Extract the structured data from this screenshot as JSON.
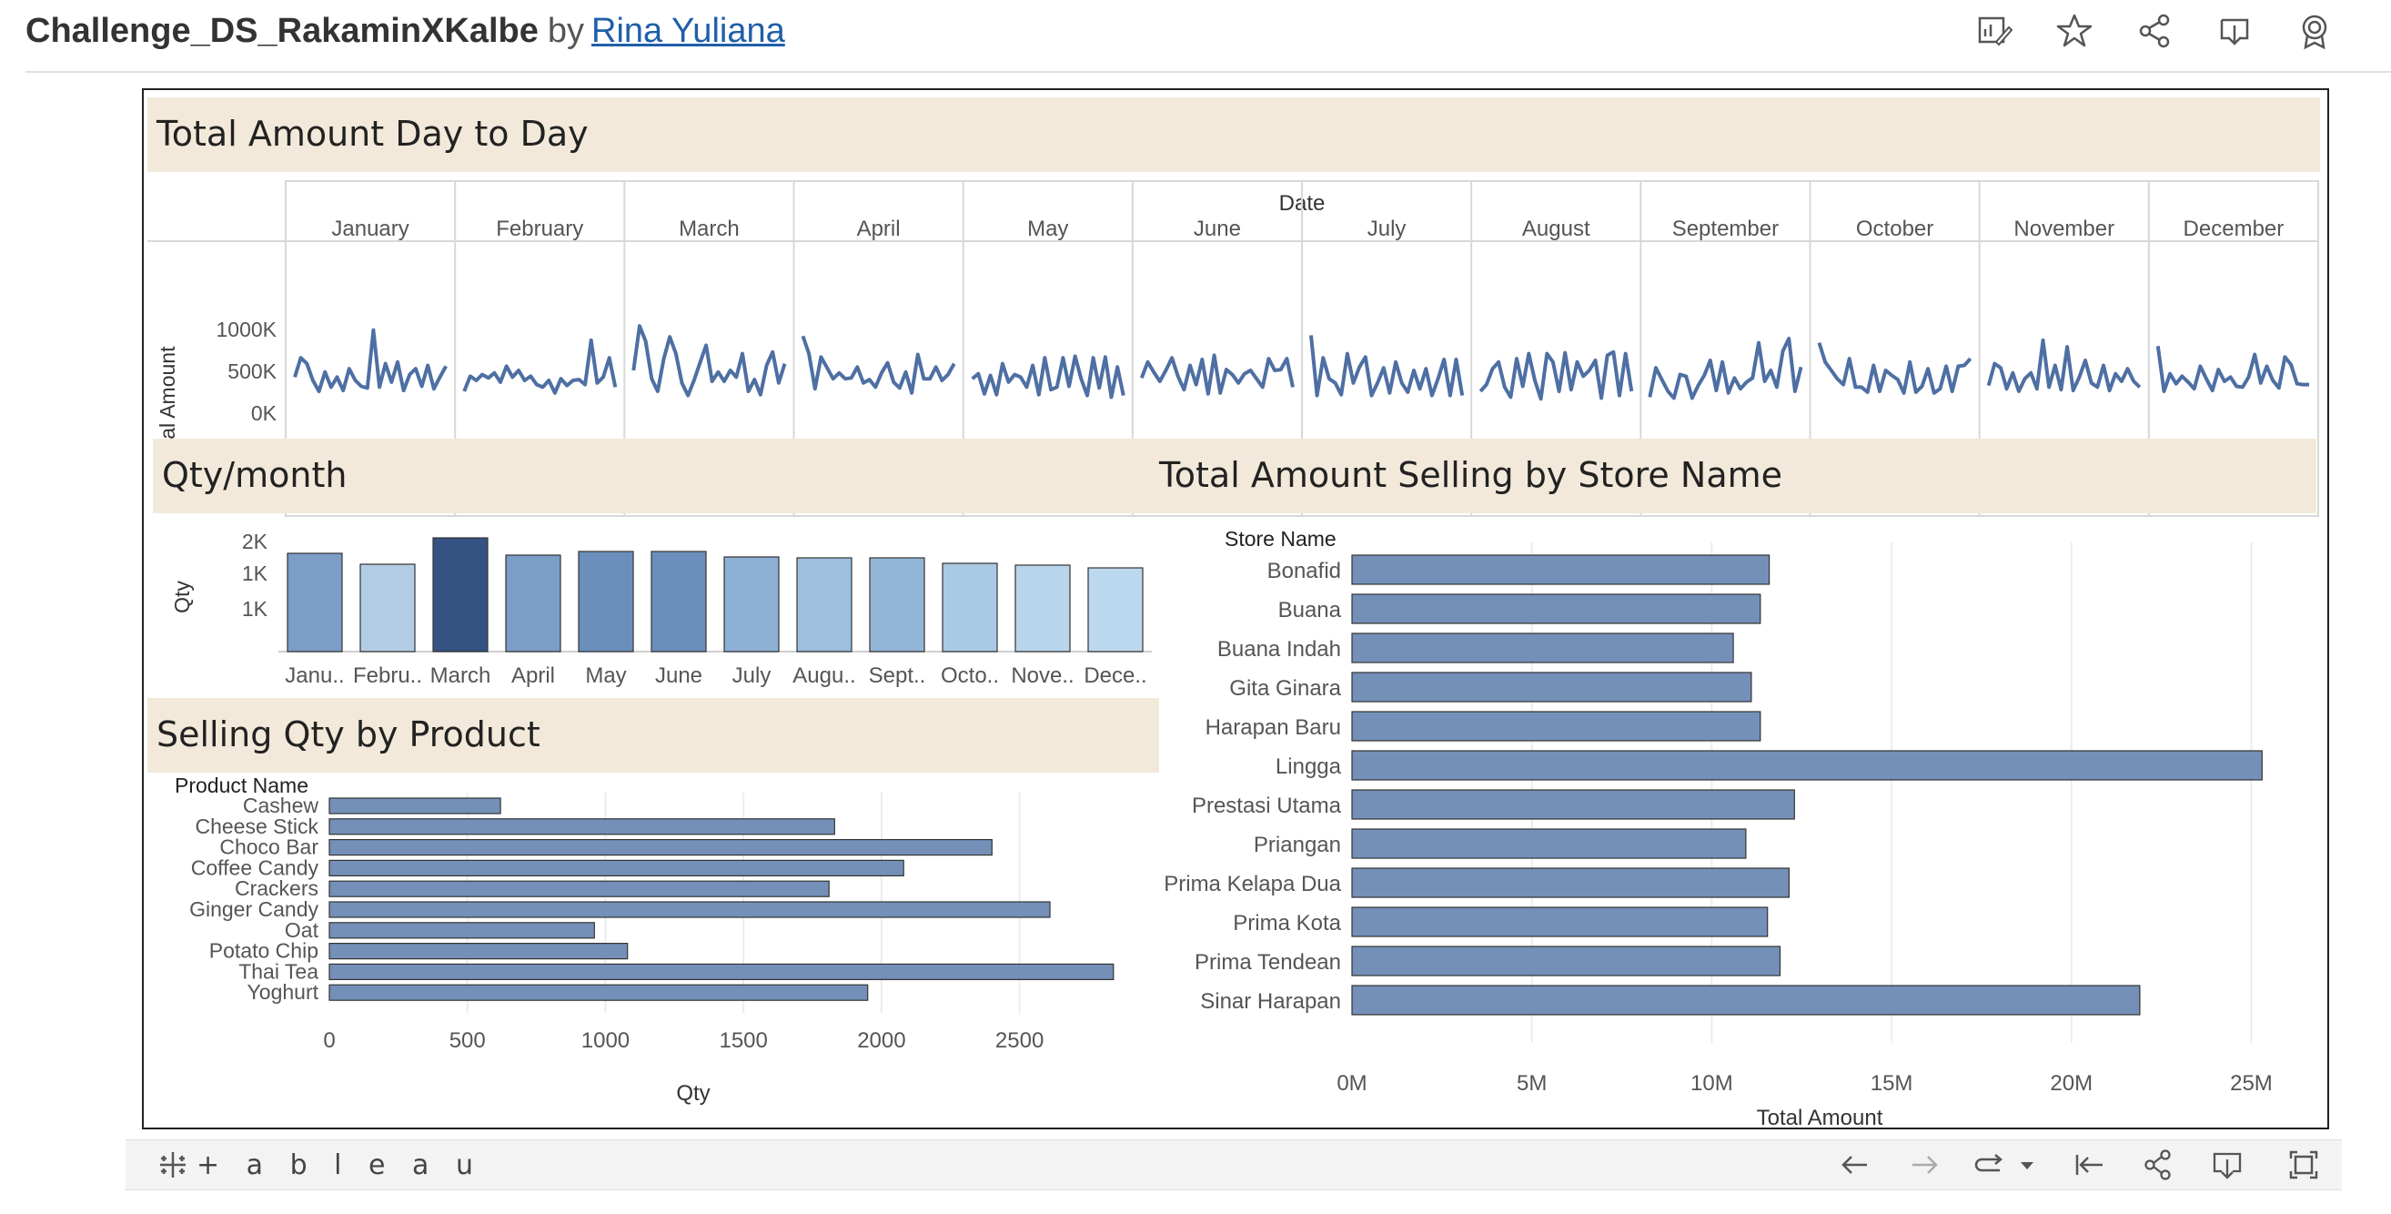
{
  "header": {
    "workbook_title": "Challenge_DS_RakaminXKalbe",
    "by_text": "by",
    "author": "Rina Yuliana",
    "icons": [
      "edit-icon",
      "star-icon",
      "share-icon",
      "download-icon",
      "badge-icon"
    ]
  },
  "colors": {
    "band": "#f2e9da",
    "line": "#4e6fa3",
    "bar": "#7490b8",
    "gridline": "#ececec"
  },
  "dashboard": {
    "section_day": "Total Amount Day to Day",
    "section_month": "Qty/month",
    "section_store": "Total Amount Selling by Store Name",
    "section_product": "Selling Qty by Product"
  },
  "chart_data": [
    {
      "type": "line",
      "title": "Total Amount Day to Day",
      "header_label": "Date",
      "ylabel": "Total Amount",
      "ylim": [
        0,
        1000000
      ],
      "ytick_labels": [
        "1000K",
        "500K",
        "0K"
      ],
      "ytick_values": [
        1000000,
        500000,
        0
      ],
      "months": [
        "January",
        "February",
        "March",
        "April",
        "May",
        "June",
        "July",
        "August",
        "September",
        "October",
        "November",
        "December"
      ],
      "series": [
        [
          420,
          650,
          580,
          380,
          250,
          480,
          300,
          420,
          260,
          520,
          380,
          310,
          290,
          980,
          300,
          580,
          360,
          600,
          260,
          450,
          520,
          310,
          560,
          280,
          420,
          550
        ],
        [
          250,
          430,
          380,
          450,
          410,
          470,
          360,
          550,
          420,
          500,
          380,
          430,
          330,
          300,
          380,
          230,
          400,
          320,
          380,
          390,
          330,
          860,
          350,
          420,
          650,
          300
        ],
        [
          500,
          1030,
          850,
          400,
          250,
          640,
          900,
          700,
          350,
          200,
          380,
          590,
          800,
          370,
          480,
          370,
          500,
          420,
          700,
          250,
          390,
          210,
          560,
          720,
          350,
          580
        ],
        [
          910,
          700,
          280,
          660,
          530,
          400,
          470,
          400,
          410,
          540,
          350,
          390,
          300,
          470,
          590,
          360,
          290,
          480,
          230,
          690,
          400,
          400,
          540,
          380,
          450,
          580
        ],
        [
          400,
          460,
          220,
          440,
          210,
          580,
          360,
          450,
          420,
          300,
          560,
          210,
          650,
          270,
          300,
          650,
          310,
          670,
          400,
          200,
          650,
          290,
          660,
          180,
          540,
          200
        ],
        [
          410,
          600,
          480,
          370,
          500,
          650,
          430,
          270,
          560,
          330,
          630,
          220,
          680,
          230,
          510,
          450,
          350,
          460,
          500,
          400,
          300,
          640,
          500,
          510,
          640,
          300
        ],
        [
          920,
          200,
          650,
          400,
          350,
          210,
          700,
          350,
          540,
          660,
          200,
          350,
          530,
          230,
          600,
          350,
          240,
          500,
          280,
          520,
          200,
          400,
          630,
          200,
          630,
          200
        ],
        [
          250,
          330,
          520,
          600,
          300,
          180,
          640,
          310,
          700,
          380,
          160,
          700,
          600,
          250,
          710,
          270,
          600,
          430,
          500,
          620,
          170,
          680,
          720,
          200,
          700,
          250
        ],
        [
          180,
          530,
          390,
          250,
          170,
          450,
          430,
          170,
          320,
          440,
          620,
          260,
          600,
          230,
          410,
          280,
          360,
          410,
          830,
          370,
          500,
          300,
          730,
          880,
          250,
          540
        ],
        [
          830,
          600,
          500,
          400,
          330,
          640,
          300,
          300,
          240,
          560,
          250,
          500,
          440,
          390,
          230,
          600,
          240,
          310,
          520,
          230,
          280,
          550,
          250,
          550,
          560,
          640
        ],
        [
          320,
          580,
          530,
          280,
          470,
          250,
          400,
          470,
          280,
          860,
          300,
          560,
          270,
          780,
          260,
          420,
          620,
          350,
          300,
          560,
          260,
          460,
          370,
          520,
          370,
          300
        ],
        [
          790,
          250,
          460,
          340,
          430,
          360,
          280,
          550,
          400,
          260,
          510,
          370,
          420,
          310,
          300,
          420,
          690,
          350,
          550,
          380,
          290,
          660,
          570,
          340,
          330,
          330
        ]
      ]
    },
    {
      "type": "bar",
      "title": "Qty/month",
      "ylabel": "Qty",
      "ylim": [
        0,
        2000
      ],
      "ytick_labels": [
        "2K",
        "1K",
        "1K"
      ],
      "ytick_values": [
        2000,
        1500,
        1000
      ],
      "categories": [
        "Janu..",
        "Febru..",
        "March",
        "April",
        "May",
        "June",
        "July",
        "Augu..",
        "Sept..",
        "Octo..",
        "Nove..",
        "Dece.."
      ],
      "values": [
        1880,
        1760,
        2050,
        1860,
        1900,
        1900,
        1840,
        1830,
        1830,
        1770,
        1750,
        1720
      ],
      "bar_colors": [
        "#7b9dc6",
        "#b3cde5",
        "#345282",
        "#7b9dc6",
        "#6b8fbc",
        "#6b8fbc",
        "#8eb0d5",
        "#9ebfde",
        "#93b5d8",
        "#aac9e4",
        "#b9d5ec",
        "#bcd8ee"
      ]
    },
    {
      "type": "bar",
      "orientation": "horizontal",
      "title": "Selling Qty by Product",
      "category_header": "Product Name",
      "xlabel": "Qty",
      "xlim": [
        0,
        2900
      ],
      "xtick_values": [
        0,
        500,
        1000,
        1500,
        2000,
        2500
      ],
      "xtick_labels": [
        "0",
        "500",
        "1000",
        "1500",
        "2000",
        "2500"
      ],
      "categories": [
        "Cashew",
        "Cheese Stick",
        "Choco Bar",
        "Coffee Candy",
        "Crackers",
        "Ginger Candy",
        "Oat",
        "Potato Chip",
        "Thai Tea",
        "Yoghurt"
      ],
      "values": [
        620,
        1830,
        2400,
        2080,
        1810,
        2610,
        960,
        1080,
        2840,
        1950
      ]
    },
    {
      "type": "bar",
      "orientation": "horizontal",
      "title": "Total Amount Selling by Store Name",
      "category_header": "Store Name",
      "xlabel": "Total Amount",
      "xlim": [
        0,
        26000000
      ],
      "xtick_values": [
        0,
        5000000,
        10000000,
        15000000,
        20000000,
        25000000
      ],
      "xtick_labels": [
        "0M",
        "5M",
        "10M",
        "15M",
        "20M",
        "25M"
      ],
      "categories": [
        "Bonafid",
        "Buana",
        "Buana Indah",
        "Gita Ginara",
        "Harapan Baru",
        "Lingga",
        "Prestasi Utama",
        "Priangan",
        "Prima Kelapa Dua",
        "Prima Kota",
        "Prima Tendean",
        "Sinar Harapan"
      ],
      "values": [
        11600000,
        11350000,
        10600000,
        11100000,
        11350000,
        25300000,
        12300000,
        10950000,
        12150000,
        11550000,
        11900000,
        21900000
      ]
    }
  ],
  "footer": {
    "logo_text": "+ a b l e a u",
    "icons": [
      "undo-icon",
      "redo-icon",
      "revert-icon",
      "dropdown-icon",
      "first-page-icon",
      "share-icon",
      "download-icon",
      "fullscreen-icon"
    ]
  }
}
